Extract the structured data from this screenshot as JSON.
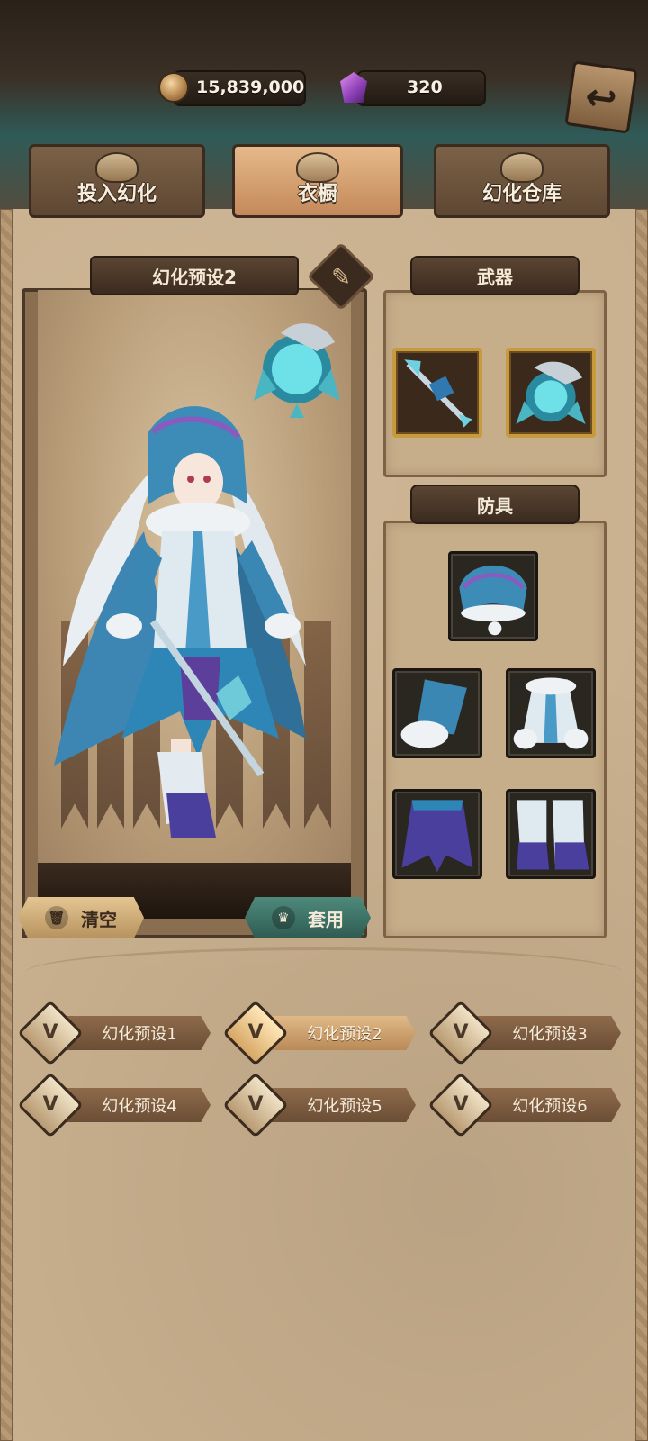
{
  "currency": {
    "gold": "15,839,000",
    "gems": "320",
    "gold_icon": "coin-icon",
    "gem_icon": "gem-icon"
  },
  "tabs": [
    {
      "label": "投入幻化",
      "icon": "mask-icon",
      "active": false
    },
    {
      "label": "衣橱",
      "icon": "wardrobe-emblem-icon",
      "active": true
    },
    {
      "label": "幻化仓库",
      "icon": "cabinet-icon",
      "active": false
    }
  ],
  "preview": {
    "title": "幻化预设2",
    "clear_label": "清空",
    "apply_label": "套用"
  },
  "equipment": {
    "weapons_title": "武器",
    "armor_title": "防具",
    "weapons": [
      "staff",
      "dragon-orb"
    ],
    "armor": [
      "hood",
      "gloves",
      "coat",
      "skirt",
      "boots"
    ]
  },
  "presets": [
    {
      "label": "幻化预设1",
      "active": false
    },
    {
      "label": "幻化预设2",
      "active": true
    },
    {
      "label": "幻化预设3",
      "active": false
    },
    {
      "label": "幻化预设4",
      "active": false
    },
    {
      "label": "幻化预设5",
      "active": false
    },
    {
      "label": "幻化预设6",
      "active": false
    }
  ],
  "colors": {
    "accent_teal": "#4e8a7c",
    "gold_frame": "#c79a3d",
    "parchment": "#c9b08e"
  }
}
